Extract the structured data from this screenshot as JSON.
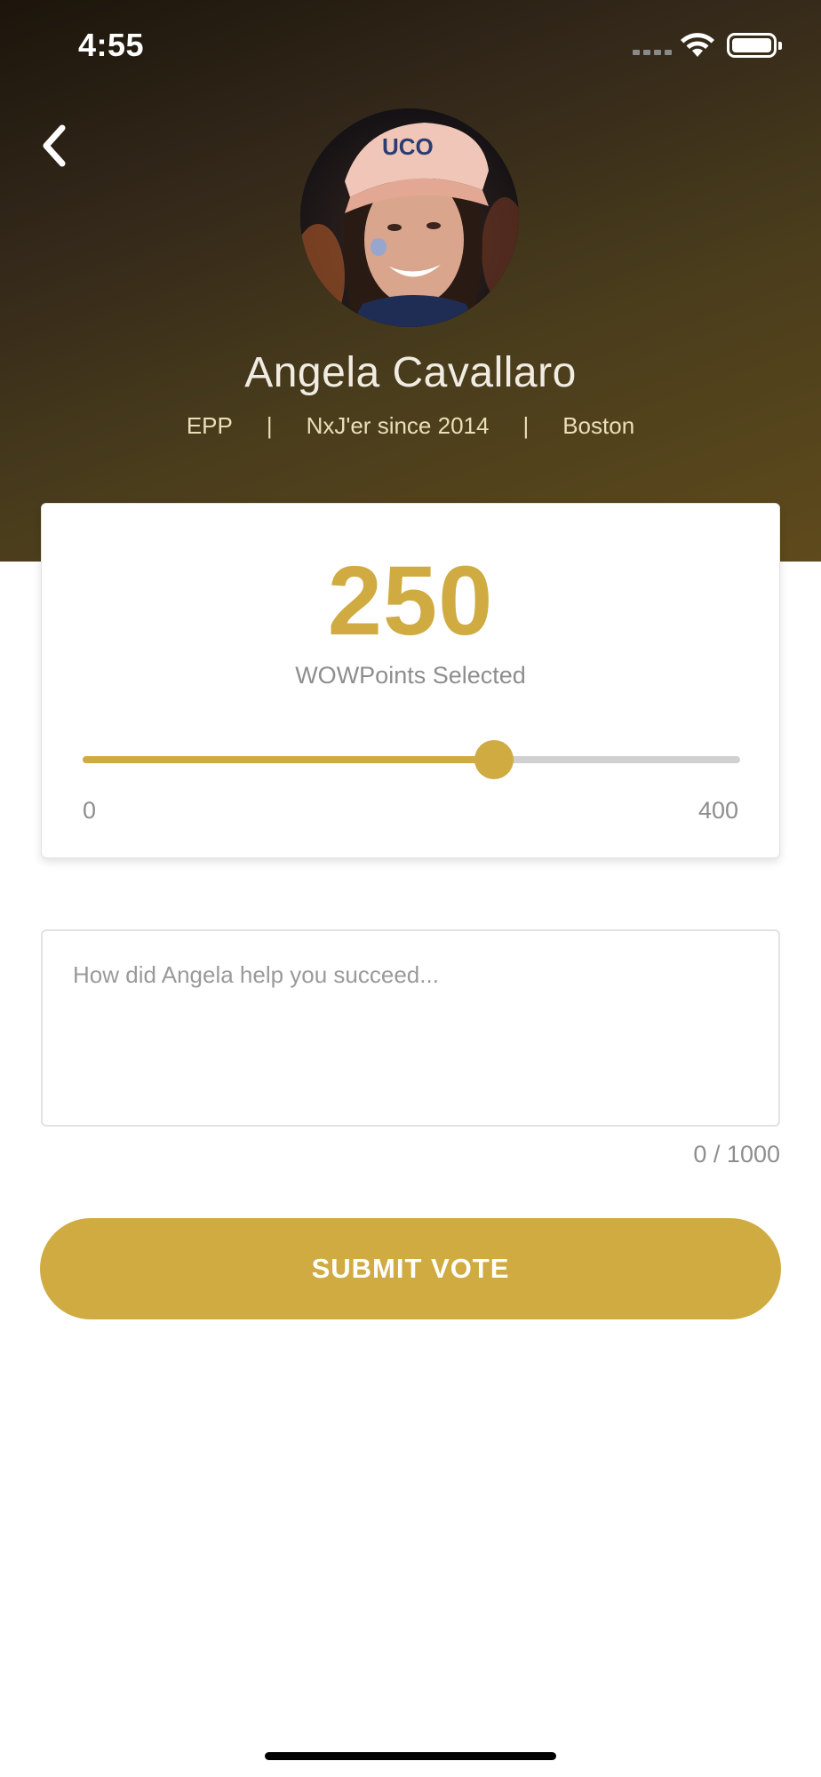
{
  "status_bar": {
    "time": "4:55",
    "icons": [
      "cellular-signal-icon",
      "wifi-icon",
      "battery-icon"
    ]
  },
  "header": {
    "back_icon": "chevron-left-icon",
    "avatar_alt": "Angela Cavallaro"
  },
  "profile": {
    "name": "Angela Cavallaro",
    "role": "EPP",
    "separator": "|",
    "tenure": "NxJ'er since 2014",
    "location": "Boston"
  },
  "points": {
    "value": "250",
    "caption": "WOWPoints Selected",
    "slider": {
      "min": 0,
      "max": 400,
      "value": 250,
      "min_label": "0",
      "max_label": "400"
    }
  },
  "message": {
    "placeholder": "How did Angela help you succeed...",
    "char_count": "0 / 1000"
  },
  "submit": {
    "label": "SUBMIT VOTE"
  },
  "colors": {
    "accent": "#cfab41",
    "header_gradient_start": "#1c150b",
    "header_gradient_end": "#5e4a1c",
    "muted_text": "#8e8e8e",
    "track": "#d0d0d0"
  }
}
